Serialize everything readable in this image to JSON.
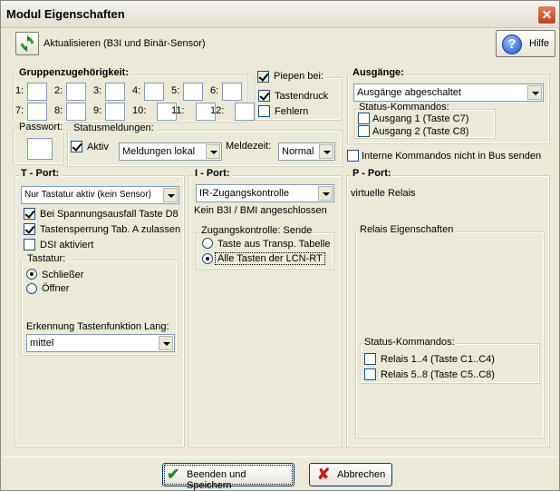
{
  "window": {
    "title": "Modul Eigenschaften"
  },
  "toolbar": {
    "refresh_label": "Aktualisieren (B3I und Binär-Sensor)",
    "help_label": "Hilfe",
    "help_icon_char": "?"
  },
  "gruppen": {
    "title": "Gruppenzugehörigkeit:",
    "labels": [
      "1:",
      "2:",
      "3:",
      "4:",
      "5:",
      "6:",
      "7:",
      "8:",
      "9:",
      "10:",
      "11:",
      "12:"
    ],
    "values": [
      "",
      "",
      "",
      "",
      "",
      "",
      "",
      "",
      "",
      "",
      "",
      ""
    ]
  },
  "piepen": {
    "label": "Piepen bei:",
    "checked": true,
    "tastendruck": {
      "label": "Tastendruck",
      "checked": true
    },
    "fehlern": {
      "label": "Fehlern",
      "checked": false
    }
  },
  "ausgaenge": {
    "title": "Ausgänge:",
    "select_value": "Ausgänge abgeschaltet",
    "status_title": "Status-Kommandos:",
    "items": [
      {
        "label": "Ausgang 1 (Taste C7)",
        "checked": false
      },
      {
        "label": "Ausgang 2 (Taste C8)",
        "checked": false
      }
    ]
  },
  "passwort": {
    "title": "Passwort:",
    "value": ""
  },
  "status": {
    "title": "Statusmeldungen:",
    "aktiv_label": "Aktiv",
    "aktiv_checked": true,
    "meldung_value": "Meldungen lokal",
    "meldezeit_label": "Meldezeit:",
    "meldezeit_value": "Normal"
  },
  "interne": {
    "label": "Interne Kommandos nicht in Bus senden",
    "checked": false
  },
  "tport": {
    "title": "T - Port:",
    "select_value": "Nur Tastatur aktiv (kein Sensor)",
    "options": [
      {
        "label": "Bei Spannungsausfall Taste D8",
        "checked": true
      },
      {
        "label": "Tastensperrung Tab. A zulassen",
        "checked": true
      },
      {
        "label": "DSI aktiviert",
        "checked": false
      }
    ],
    "tastatur_title": "Tastatur:",
    "radios": [
      {
        "label": "Schließer",
        "checked": true
      },
      {
        "label": "Öffner",
        "checked": false
      }
    ],
    "erkennung_label": "Erkennung Tastenfunktion Lang:",
    "erkennung_value": "mittel"
  },
  "iport": {
    "title": "I - Port:",
    "select_value": "IR-Zugangskontrolle",
    "status_text": "Kein B3I / BMI angeschlossen",
    "zugang_title": "Zugangskontrolle: Sende",
    "radios": [
      {
        "label": "Taste aus Transp. Tabelle",
        "checked": false
      },
      {
        "label": "Alle Tasten der LCN-RT",
        "checked": true
      }
    ]
  },
  "pport": {
    "title": "P - Port:",
    "subtitle": "virtuelle Relais",
    "relais_title": "Relais Eigenschaften",
    "status_title": "Status-Kommandos:",
    "items": [
      {
        "label": "Relais 1..4 (Taste C1..C4)",
        "checked": false
      },
      {
        "label": "Relais 5..8 (Taste C5..C8)",
        "checked": false
      }
    ]
  },
  "footer": {
    "save_label": "Beenden und Speichern",
    "cancel_label": "Abbrechen"
  }
}
